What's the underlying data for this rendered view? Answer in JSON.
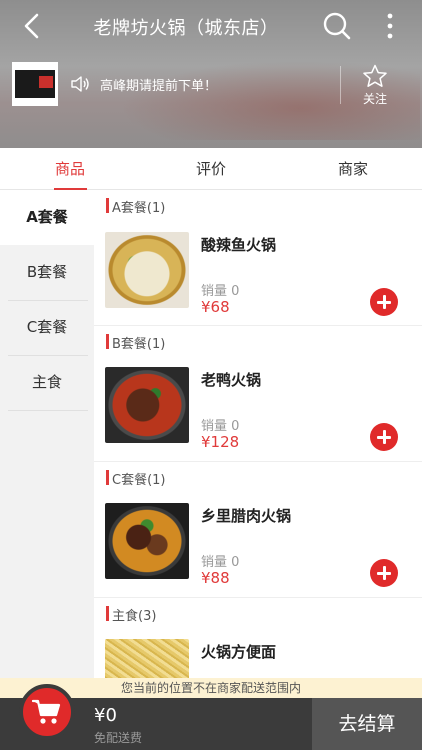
{
  "header": {
    "title": "老牌坊火锅（城东店）",
    "notice": "高峰期请提前下单！",
    "follow_label": "关注",
    "back_icon": "back-icon",
    "search_icon": "search-icon",
    "more_icon": "more-icon",
    "logo_text": "老牌坊 火锅"
  },
  "tabs": [
    {
      "label": "商品",
      "active": true
    },
    {
      "label": "评价",
      "active": false
    },
    {
      "label": "商家",
      "active": false
    }
  ],
  "sidebar": {
    "items": [
      {
        "label": "A套餐",
        "active": true
      },
      {
        "label": "B套餐",
        "active": false
      },
      {
        "label": "C套餐",
        "active": false
      },
      {
        "label": "主食",
        "active": false
      }
    ]
  },
  "menu": {
    "sections": [
      {
        "title": "A套餐(1)",
        "dish": {
          "name": "酸辣鱼火锅",
          "sales": "销量 0",
          "price": "¥68"
        }
      },
      {
        "title": "B套餐(1)",
        "dish": {
          "name": "老鸭火锅",
          "sales": "销量 0",
          "price": "¥128"
        }
      },
      {
        "title": "C套餐(1)",
        "dish": {
          "name": "乡里腊肉火锅",
          "sales": "销量 0",
          "price": "¥88"
        }
      },
      {
        "title": "主食(3)",
        "dish": {
          "name": "火锅方便面"
        }
      }
    ]
  },
  "warning": "您当前的位置不在商家配送范围内",
  "cart": {
    "total": "¥0",
    "delivery_fee": "免配送费",
    "checkout_label": "去结算"
  },
  "colors": {
    "accent": "#e03a3a",
    "cart_bar": "#3b3b3b",
    "checkout_bg": "#555555",
    "warning_bg": "#fdf2d2"
  }
}
